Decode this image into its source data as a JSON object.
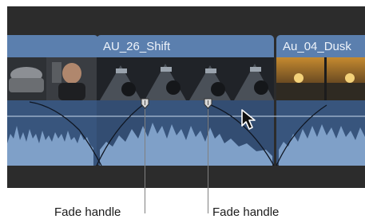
{
  "clips": [
    {
      "title": ""
    },
    {
      "title": "AU_26_Shift"
    },
    {
      "title": "Au_04_Dusk"
    }
  ],
  "callouts": {
    "left": "Fade handle",
    "right": "Fade handle"
  },
  "icons": {
    "handle": "fade-handle-icon",
    "cursor": "pointer-cursor-icon"
  },
  "colors": {
    "timeline_bg": "#2c2c2c",
    "clip_fill": "#5b7fae",
    "audio_fill": "#38557d",
    "waveform": "#7fa0c8"
  }
}
